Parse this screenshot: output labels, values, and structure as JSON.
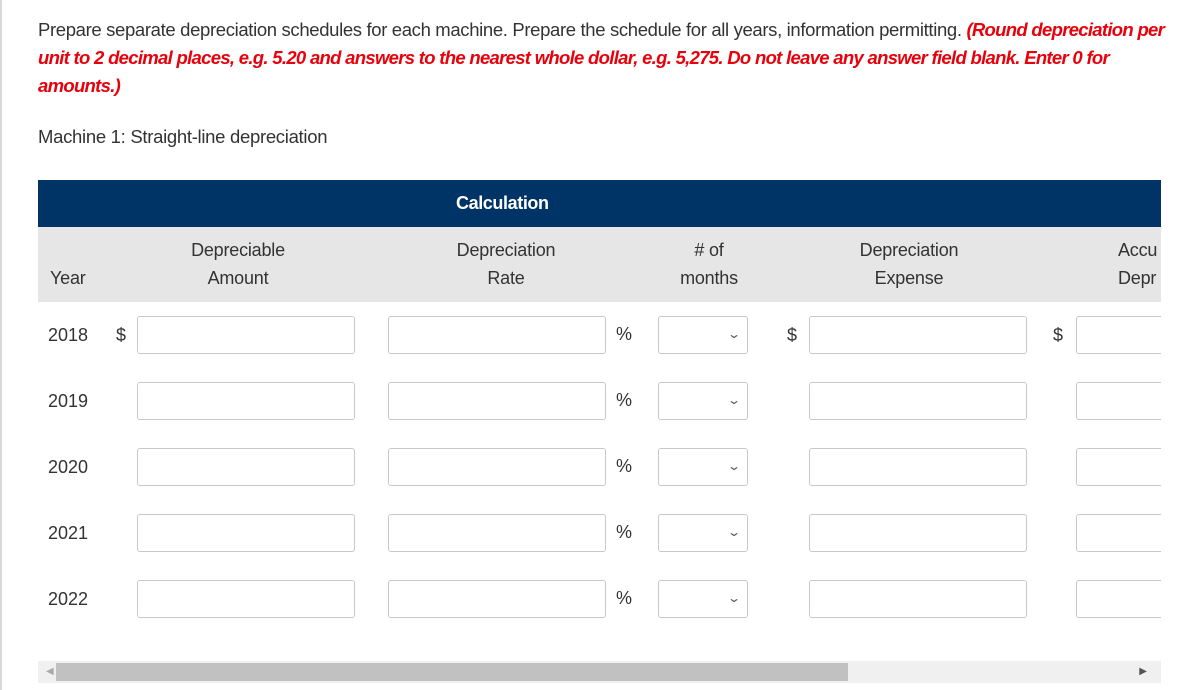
{
  "instructions": {
    "main": "Prepare separate depreciation schedules for each machine. Prepare the schedule for all years, information permitting. ",
    "emphasis": "(Round depreciation per unit to 2 decimal places, e.g. 5.20 and answers to the nearest whole dollar, e.g. 5,275. Do not leave any answer field blank. Enter 0 for amounts.)"
  },
  "subtitle": "Machine 1: Straight-line depreciation",
  "table": {
    "group_header": "Calculation",
    "headers": {
      "year": "Year",
      "depreciable_amount": [
        "Depreciable",
        "Amount"
      ],
      "depreciation_rate": [
        "Depreciation",
        "Rate"
      ],
      "num_months": [
        "# of",
        "months"
      ],
      "depreciation_expense": [
        "Depreciation",
        "Expense"
      ],
      "accumulated_depreciation": [
        "Accu",
        "Depr"
      ]
    },
    "currency_symbol": "$",
    "percent_symbol": "%",
    "rows": [
      {
        "year": "2018",
        "show_currency": true,
        "depreciable_amount": "",
        "rate": "",
        "months": "",
        "expense": "",
        "accumulated": ""
      },
      {
        "year": "2019",
        "show_currency": false,
        "depreciable_amount": "",
        "rate": "",
        "months": "",
        "expense": "",
        "accumulated": ""
      },
      {
        "year": "2020",
        "show_currency": false,
        "depreciable_amount": "",
        "rate": "",
        "months": "",
        "expense": "",
        "accumulated": ""
      },
      {
        "year": "2021",
        "show_currency": false,
        "depreciable_amount": "",
        "rate": "",
        "months": "",
        "expense": "",
        "accumulated": ""
      },
      {
        "year": "2022",
        "show_currency": false,
        "depreciable_amount": "",
        "rate": "",
        "months": "",
        "expense": "",
        "accumulated": ""
      }
    ]
  },
  "icons": {
    "chevron_down": "⌄",
    "scroll_left": "◀",
    "scroll_right": "▶"
  }
}
